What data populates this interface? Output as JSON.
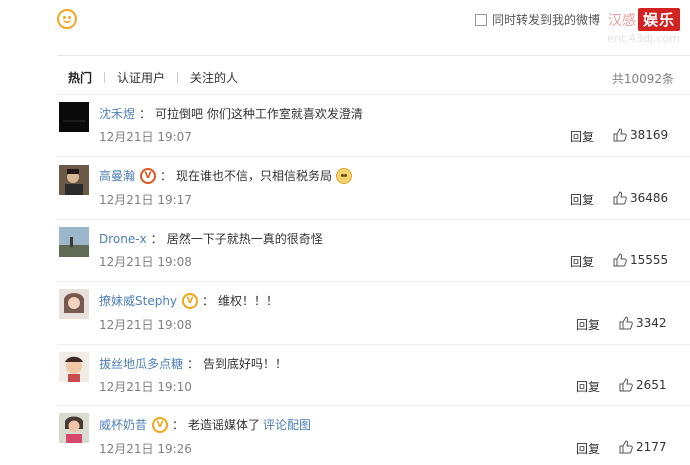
{
  "forward": {
    "label": "同时转发到我的微博"
  },
  "watermark": {
    "prefix": "汉感",
    "brand": "娱乐",
    "url": "ent.43dj.com"
  },
  "tabs": [
    {
      "label": "热门"
    },
    {
      "label": "认证用户"
    },
    {
      "label": "关注的人"
    }
  ],
  "total": "共10092条",
  "reply_label": "回复",
  "comments": [
    {
      "user": "沈禾煜",
      "text": "可拉倒吧 你们这种工作室就喜欢发澄清",
      "time": "12月21日 19:07",
      "likes": "38169"
    },
    {
      "user": "高曼瀚",
      "text": "现在谁也不信，只相信税务局",
      "time": "12月21日 19:17",
      "likes": "36486"
    },
    {
      "user": "Drone-x",
      "text": "居然一下子就热一真的很奇怪",
      "time": "12月21日 19:08",
      "likes": "15555"
    },
    {
      "user": "撩妹威Stephy",
      "text": "维权！！！",
      "time": "12月21日 19:08",
      "likes": "3342"
    },
    {
      "user": "拔丝地瓜多点糖",
      "text": "告到底好吗！！",
      "time": "12月21日 19:10",
      "likes": "2651"
    },
    {
      "user": "威杯奶昔",
      "text": "老造谣媒体了",
      "link": "评论配图",
      "time": "12月21日 19:26",
      "likes": "2177"
    }
  ],
  "colors": {
    "username": "#4d7fb6",
    "meta": "#808080",
    "badge_gold": "#f2a51b",
    "badge_red": "#e0541d",
    "watermark_red": "#d22222"
  }
}
